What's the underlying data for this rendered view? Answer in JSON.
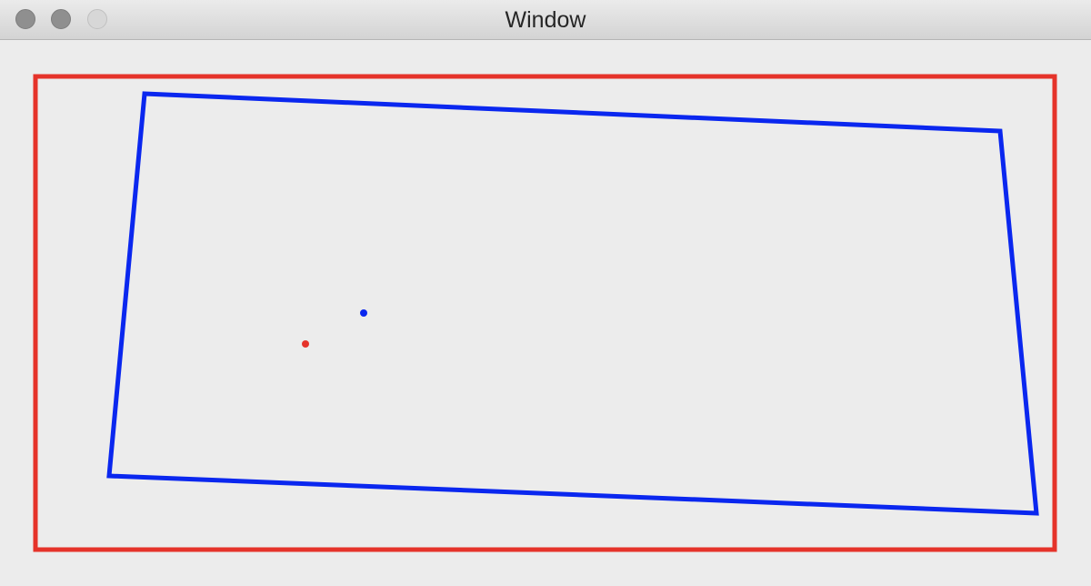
{
  "window": {
    "title": "Window"
  },
  "colors": {
    "background": "#ececec",
    "frame": "#e5332a",
    "quad": "#0a27ef"
  },
  "canvas": {
    "shapes": [
      "outer-rectangle",
      "inner-quadrilateral",
      "red-point",
      "blue-point"
    ]
  }
}
